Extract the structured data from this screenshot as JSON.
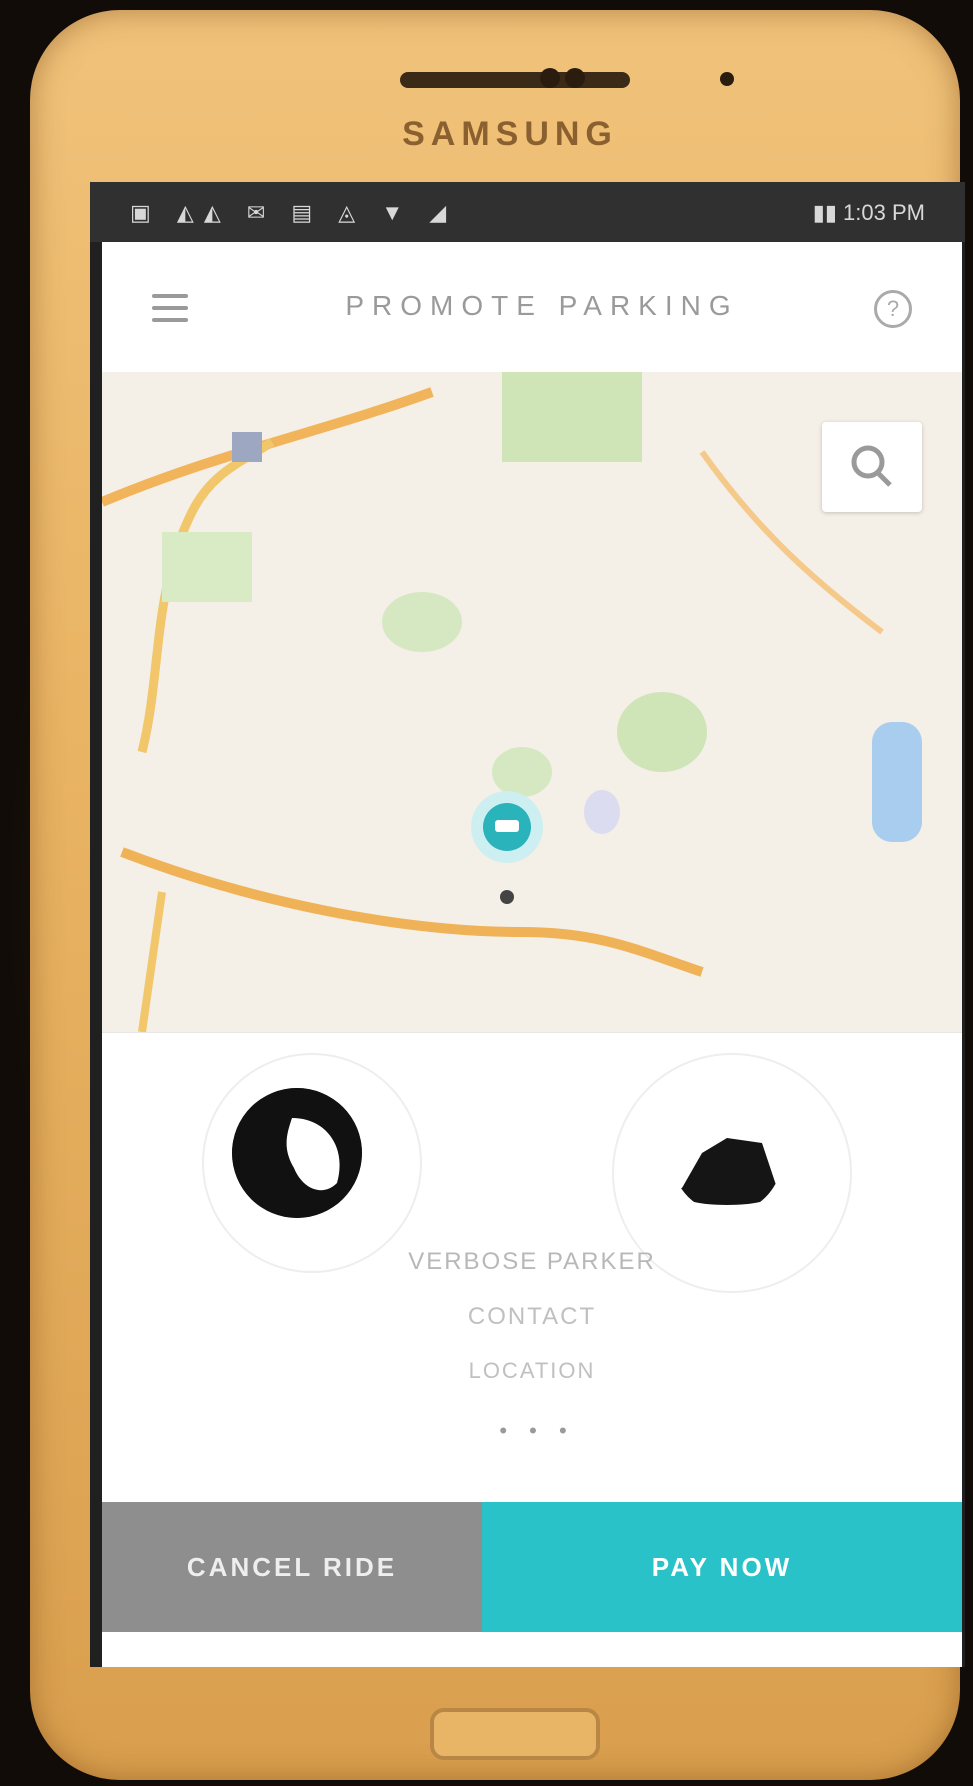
{
  "device": {
    "brand": "SAMSUNG"
  },
  "statusbar": {
    "icons": "▣ ◭◭ ✉ ▤ ◬ ▼ ◢",
    "right": "▮▮ 1:03 PM"
  },
  "appbar": {
    "title": "PROMOTE PARKING"
  },
  "sheet": {
    "driver_line1": "VERBOSE PARKER",
    "driver_line2": "CONTACT",
    "driver_line3": "LOCATION",
    "pager": "• • •"
  },
  "actions": {
    "cancel_label": "CANCEL RIDE",
    "pay_label": "PAY NOW"
  },
  "colors": {
    "accent": "#2ac2c9",
    "cancel": "#8e8e8e",
    "phone": "#e9b464"
  },
  "icons": {
    "menu": "hamburger-icon",
    "help": "help-icon",
    "search": "search-icon",
    "car": "car-marker-icon"
  }
}
